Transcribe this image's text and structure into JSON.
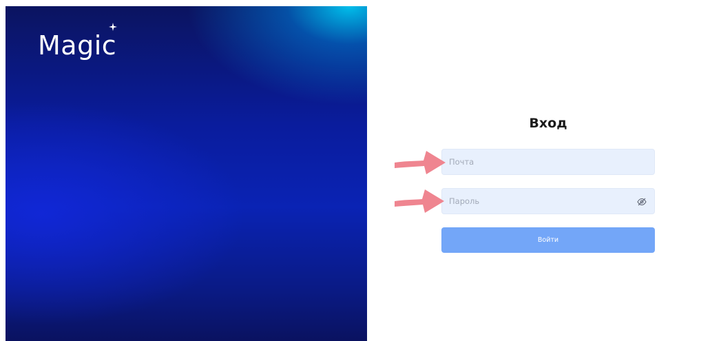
{
  "brand": {
    "logo_text": "Magic",
    "colors": {
      "panel_dark": "#0b1460",
      "panel_mid": "#0a23b4",
      "panel_accent": "#00bee9"
    }
  },
  "form": {
    "title": "Вход",
    "email": {
      "value": "",
      "placeholder": "Почта"
    },
    "password": {
      "value": "",
      "placeholder": "Пароль",
      "toggle_icon": "eye-slash-icon"
    },
    "submit_label": "Войти",
    "colors": {
      "field_bg": "#e8f0fd",
      "button_bg": "#73a6f8",
      "annotation_arrow": "#ef8590"
    }
  }
}
